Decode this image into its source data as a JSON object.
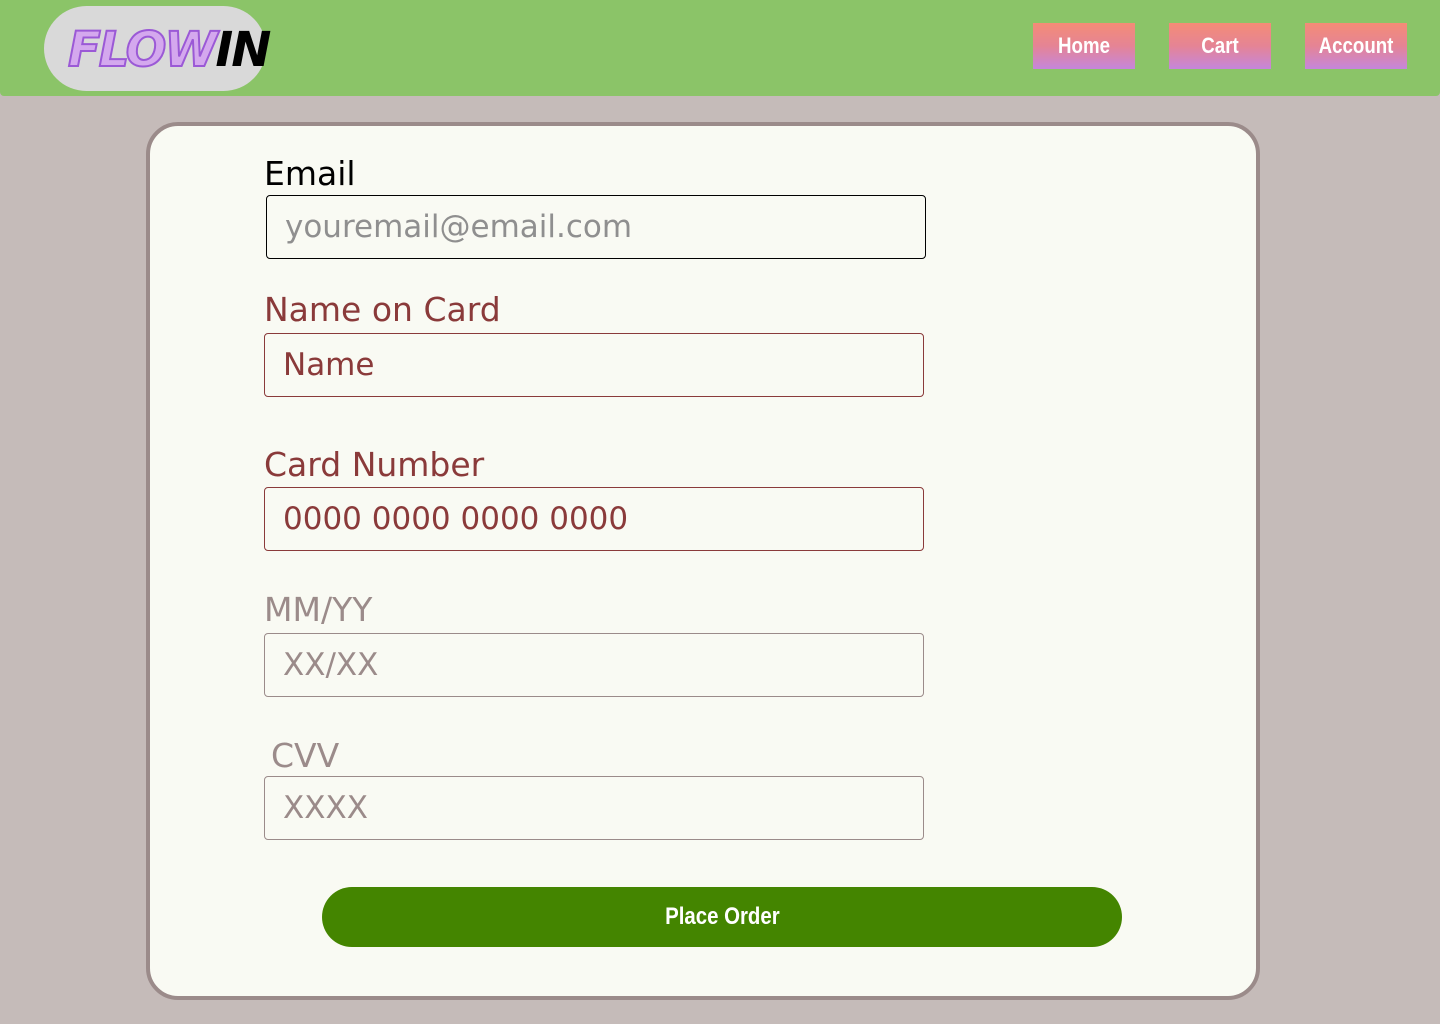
{
  "header": {
    "logo": {
      "part1": "FLOW",
      "part2": "IN"
    },
    "nav": [
      {
        "label": "Home"
      },
      {
        "label": "Cart"
      },
      {
        "label": "Account"
      }
    ]
  },
  "form": {
    "email": {
      "label": "Email",
      "placeholder": "youremail@email.com"
    },
    "name_on_card": {
      "label": "Name on Card",
      "placeholder": "Name"
    },
    "card_number": {
      "label": "Card Number",
      "placeholder": "0000 0000 0000 0000"
    },
    "expiry": {
      "label": "MM/YY",
      "placeholder": "XX/XX"
    },
    "cvv": {
      "label": "CVV",
      "placeholder": "XXXX"
    },
    "submit_label": "Place Order"
  },
  "colors": {
    "header_bg": "#8bc468",
    "page_bg": "#c5bbb9",
    "card_bg": "#f9faf3",
    "submit_bg": "#448500",
    "error_red": "#8a3a3a",
    "muted_gray": "#9b8b8a"
  }
}
